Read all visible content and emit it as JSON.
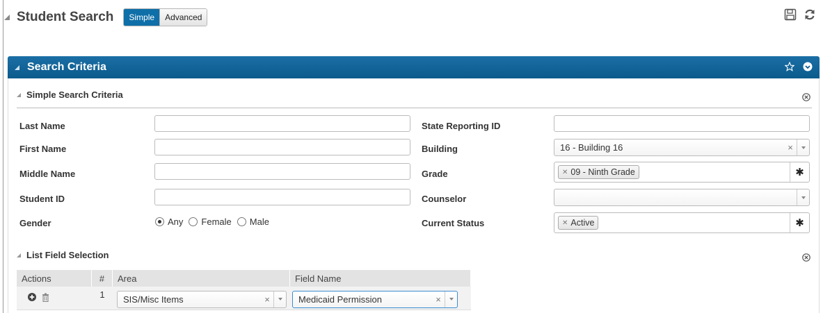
{
  "header": {
    "title": "Student Search",
    "modes": [
      "Simple",
      "Advanced"
    ],
    "active_mode": "Simple",
    "icons": [
      "save-icon",
      "refresh-icon"
    ]
  },
  "panel": {
    "title": "Search Criteria",
    "icons": [
      "star-icon",
      "chevron-down-circle-icon"
    ],
    "accent_color": "#0b5a8c"
  },
  "simple": {
    "title": "Simple Search Criteria",
    "last_name_label": "Last Name",
    "last_name_value": "",
    "first_name_label": "First Name",
    "first_name_value": "",
    "middle_name_label": "Middle Name",
    "middle_name_value": "",
    "student_id_label": "Student ID",
    "student_id_value": "",
    "gender_label": "Gender",
    "gender_options": [
      "Any",
      "Female",
      "Male"
    ],
    "gender_selected": "Any",
    "state_id_label": "State Reporting ID",
    "state_id_value": "",
    "building_label": "Building",
    "building_value": "16 - Building 16",
    "grade_label": "Grade",
    "grade_tags": [
      "09 - Ninth Grade"
    ],
    "counselor_label": "Counselor",
    "counselor_value": "",
    "status_label": "Current Status",
    "status_tags": [
      "Active"
    ]
  },
  "list": {
    "title": "List Field Selection",
    "columns": [
      "Actions",
      "#",
      "Area",
      "Field Name"
    ],
    "rows": [
      {
        "num": "1",
        "area": "SIS/Misc Items",
        "field": "Medicaid Permission"
      }
    ]
  }
}
